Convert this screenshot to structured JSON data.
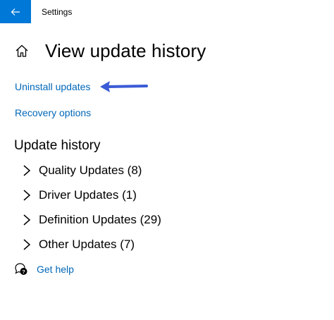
{
  "window": {
    "title": "Settings",
    "accent_color": "#0078d7"
  },
  "header": {
    "title": "View update history",
    "home_icon": "home-icon",
    "back_icon": "back-arrow-icon"
  },
  "links": {
    "uninstall_label": "Uninstall updates",
    "recovery_label": "Recovery options",
    "link_color": "#0067b8"
  },
  "annotation": {
    "arrow_color": "#3b5bd6",
    "points_to": "Uninstall updates"
  },
  "history": {
    "title": "Update history",
    "categories": [
      {
        "label": "Quality Updates (8)"
      },
      {
        "label": "Driver Updates (1)"
      },
      {
        "label": "Definition Updates (29)"
      },
      {
        "label": "Other Updates (7)"
      }
    ]
  },
  "help": {
    "label": "Get help",
    "icon": "help-chat-icon"
  }
}
